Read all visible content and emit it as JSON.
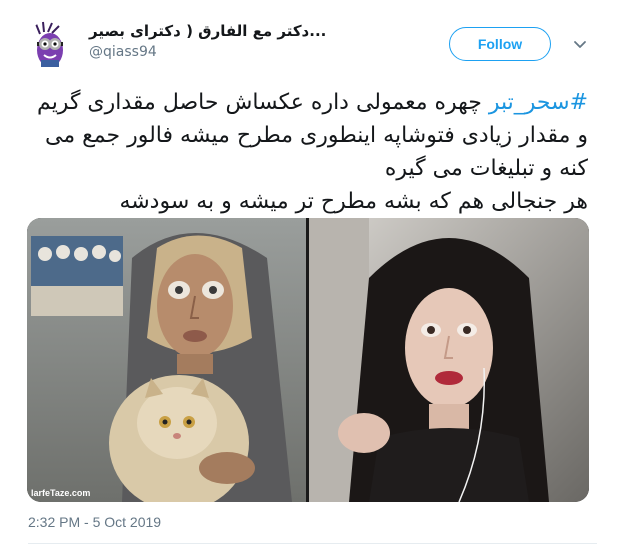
{
  "author": {
    "display_name": "دکتر مع الفارق ( دکترای بصیر...",
    "handle": "@qiass94",
    "avatar_icon": "minion-avatar-icon"
  },
  "follow_button": {
    "label": "Follow"
  },
  "menu": {
    "icon": "chevron-down-icon"
  },
  "tweet": {
    "hashtag": "#سحر_تبر",
    "line1_rest": " چهره معمولی داره عکساش حاصل مقداری گریم",
    "line2": "و مقدار زیادی فتوشاپه اینطوری مطرح میشه فالور جمع می",
    "line3": "کنه و تبلیغات می گیره",
    "line4": "هر جنجالی هم  که بشه مطرح تر میشه و به سودشه"
  },
  "media": {
    "watermark": "larfeTaze.com"
  },
  "timestamp": "2:32 PM - 5 Oct 2019",
  "colors": {
    "accent": "#1da1f2",
    "hashtag": "#1b95e0",
    "text": "#14171a",
    "muted": "#657786"
  }
}
